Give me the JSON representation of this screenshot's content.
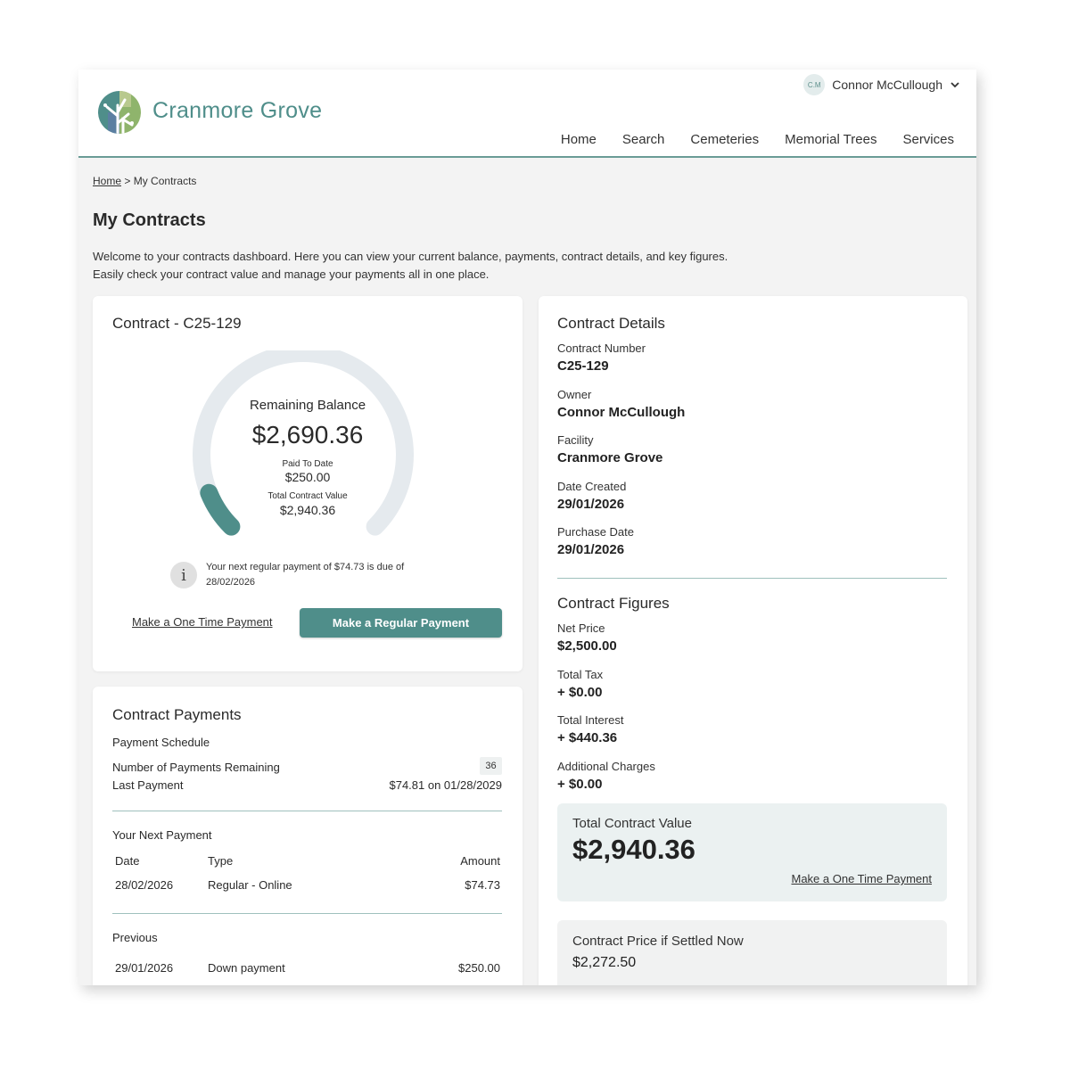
{
  "header": {
    "brand": "Cranmore Grove",
    "user": {
      "initials": "C.M",
      "name": "Connor McCullough"
    },
    "nav": [
      "Home",
      "Search",
      "Cemeteries",
      "Memorial Trees",
      "Services"
    ]
  },
  "breadcrumb": {
    "home": "Home",
    "separator": ">",
    "current": "My Contracts"
  },
  "page": {
    "title": "My Contracts",
    "intro_line1": "Welcome to your contracts dashboard. Here you can view your current balance, payments, contract details, and key figures.",
    "intro_line2": "Easily check your contract value and manage your payments all in one place."
  },
  "balance_card": {
    "title": "Contract - C25-129",
    "remaining_label": "Remaining Balance",
    "remaining_value": "$2,690.36",
    "paid_label": "Paid To Date",
    "paid_value": "$250.00",
    "total_label": "Total Contract Value",
    "total_value": "$2,940.36",
    "paid_fraction": 0.085,
    "next_message": "Your next regular payment of $74.73 is due of 28/02/2026",
    "one_time_label": "Make a One Time Payment",
    "regular_label": "Make a Regular Payment"
  },
  "payments_card": {
    "title": "Contract Payments",
    "schedule_heading": "Payment Schedule",
    "remaining_label": "Number of Payments Remaining",
    "remaining_count": "36",
    "last_label": "Last Payment",
    "last_value": "$74.81 on 01/28/2029",
    "next_heading": "Your Next Payment",
    "columns": {
      "date": "Date",
      "type": "Type",
      "amount": "Amount"
    },
    "next_row": {
      "date": "28/02/2026",
      "type": "Regular - Online",
      "amount": "$74.73"
    },
    "previous_heading": "Previous",
    "previous_row": {
      "date": "29/01/2026",
      "type": "Down payment",
      "amount": "$250.00"
    }
  },
  "details_card": {
    "title": "Contract Details",
    "fields": [
      {
        "label": "Contract Number",
        "value": "C25-129"
      },
      {
        "label": "Owner",
        "value": "Connor McCullough"
      },
      {
        "label": "Facility",
        "value": "Cranmore Grove"
      },
      {
        "label": "Date Created",
        "value": "29/01/2026"
      },
      {
        "label": "Purchase Date",
        "value": "29/01/2026"
      }
    ],
    "figures_title": "Contract Figures",
    "figures": [
      {
        "label": "Net Price",
        "value": "$2,500.00"
      },
      {
        "label": "Total Tax",
        "value": "+ $0.00"
      },
      {
        "label": "Total Interest",
        "value": "+ $440.36"
      },
      {
        "label": "Additional Charges",
        "value": "+ $0.00"
      }
    ],
    "total_box": {
      "label": "Total Contract Value",
      "value": "$2,940.36",
      "link": "Make a One Time Payment"
    },
    "settle_box": {
      "label": "Contract Price if Settled Now",
      "value": "$2,272.50"
    }
  },
  "colors": {
    "accent": "#4f8e8a",
    "track": "#e5eaee",
    "divider": "#9fc0bd"
  }
}
